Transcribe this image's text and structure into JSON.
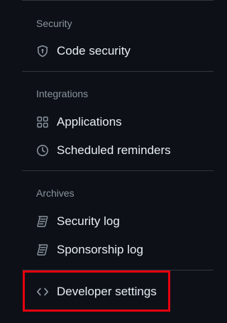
{
  "sections": {
    "security": {
      "title": "Security",
      "items": [
        {
          "label": "Code security",
          "icon": "shield-icon"
        }
      ]
    },
    "integrations": {
      "title": "Integrations",
      "items": [
        {
          "label": "Applications",
          "icon": "apps-grid-icon"
        },
        {
          "label": "Scheduled reminders",
          "icon": "clock-icon"
        }
      ]
    },
    "archives": {
      "title": "Archives",
      "items": [
        {
          "label": "Security log",
          "icon": "log-icon"
        },
        {
          "label": "Sponsorship log",
          "icon": "log-icon"
        }
      ]
    }
  },
  "developer": {
    "label": "Developer settings",
    "icon": "code-icon"
  },
  "colors": {
    "background": "#0d1117",
    "text": "#e6edf3",
    "muted": "#8b949e",
    "divider": "#30363d",
    "highlight": "#e5000f"
  }
}
